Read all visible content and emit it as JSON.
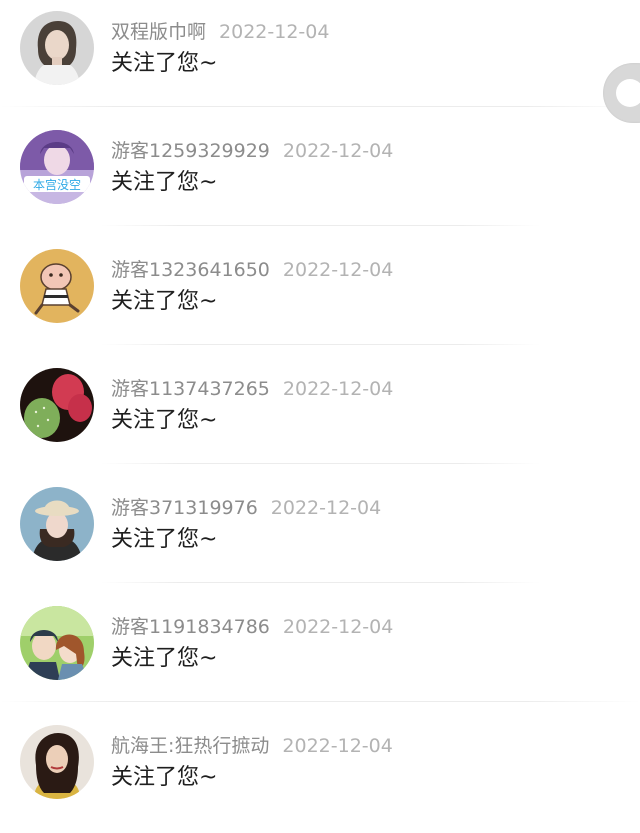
{
  "notifications": [
    {
      "username": "双程版巾啊",
      "date": "2022-12-04",
      "message": "关注了您~",
      "avatar_icon": "woman-short-hair-avatar-icon"
    },
    {
      "username": "游客1259329929",
      "date": "2022-12-04",
      "message": "关注了您~",
      "avatar_icon": "purple-girl-avatar-icon",
      "avatar_caption": "本宫没空"
    },
    {
      "username": "游客1323641650",
      "date": "2022-12-04",
      "message": "关注了您~",
      "avatar_icon": "cartoon-pig-karate-avatar-icon"
    },
    {
      "username": "游客1137437265",
      "date": "2022-12-04",
      "message": "关注了您~",
      "avatar_icon": "cactus-flower-avatar-icon"
    },
    {
      "username": "游客371319976",
      "date": "2022-12-04",
      "message": "关注了您~",
      "avatar_icon": "girl-with-hat-avatar-icon"
    },
    {
      "username": "游客1191834786",
      "date": "2022-12-04",
      "message": "关注了您~",
      "avatar_icon": "anime-couple-avatar-icon"
    },
    {
      "username": "航海王:狂热行摭动",
      "date": "2022-12-04",
      "message": "关注了您~",
      "avatar_icon": "woman-long-hair-avatar-icon"
    }
  ],
  "colors": {
    "username": "#8c8c8c",
    "date": "#b3b3b3",
    "message": "#1f1f1f",
    "divider": "#ececec",
    "scroll_handle": "#d8d8d8"
  }
}
